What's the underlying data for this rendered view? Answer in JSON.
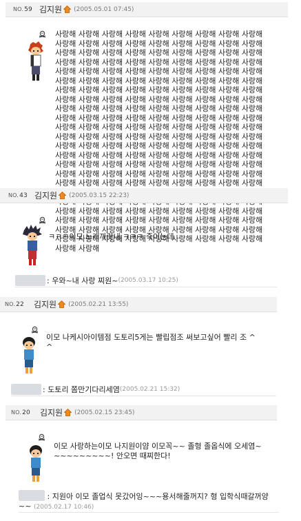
{
  "posts": [
    {
      "no_label": "NO.",
      "no": "59",
      "author": "김지원",
      "date": "(2005.05.01 07:45)",
      "body": "사랑해 사랑해 사랑해 사랑해 사랑해 사랑해 사랑해 사랑해 사랑해 사랑해 사랑해 사랑해 사랑해 사랑해 사랑해 사랑해 사랑해 사랑해 사랑해 사랑해 사랑해 사랑해 사랑해 사랑해 사랑해 사랑해 사랑해 사랑해 사랑해 사랑해 사랑해 사랑해 사랑해 사랑해 사랑해 사랑해 사랑해 사랑해 사랑해 사랑해 사랑해 사랑해 사랑해 사랑해 사랑해 사랑해 사랑해 사랑해 사랑해 사랑해 사랑해 사랑해 사랑해 사랑해 사랑해 사랑해 사랑해 사랑해 사랑해 사랑해 사랑해 사랑해 사랑해 사랑해 사랑해 사랑해 사랑해 사랑해 사랑해 사랑해 사랑해 사랑해 사랑해 사랑해 사랑해 사랑해 사랑해 사랑해 사랑해 사랑해 사랑해 사랑해 사랑해 사랑해 사랑해 사랑해 사랑해 사랑해 사랑해 사랑해 사랑해 사랑해 사랑해 사랑해 사랑해 사랑해 사랑해 사랑해 사랑해 사랑해 사랑해 사랑해 사랑해 사랑해 사랑해 사랑해 사랑해 사랑해 사랑해 사랑해 사랑해 사랑해 사랑해 사랑해 사랑해 사랑해 사랑해 사랑해 사랑해 사랑해 사랑해 사랑해 사랑해 사랑해 사랑해 사랑해 사랑해 사랑해 사랑해 사랑해 사랑해 사랑해 사랑해 사랑해 사랑해 사랑해 사랑해 사랑해 사랑해 사랑해 사랑해 사랑해 사랑해 사랑해 사랑해 사랑해 사랑해 사랑해 사랑해 사랑해 사랑해 사랑해 사랑해 사랑해 사랑해 사랑해 사랑해 사랑해 사랑해 사랑해 사랑해 사랑해 사랑해 사랑해 사랑해 사랑해 사랑해 사랑해 사랑해 사랑해 사랑해 사랑해 사랑해 사랑해 사랑해 사랑해 사랑해 사랑해 사랑해 사랑해 사랑해 사랑해 사랑해 사랑해 사랑해 사랑해 사랑해 사랑해 사랑해 사랑해 사랑해 사랑해 사랑해 사랑해 사랑해 사랑해 사랑해 사랑해 사랑해 사랑해 사랑해 사랑해 사랑해 사랑해 사랑해 사랑해 사랑해 사랑해 사랑해"
    },
    {
      "no_label": "NO.",
      "no": "43",
      "author": "김지원",
      "date": "(2005.03.15 22:23)",
      "body": "ㅋㅋㅋ이모 노래까랏내 ㅋㅋㅋ 죽이는데",
      "comment": {
        "text": ": 우와~내 사랑 찌원~",
        "date": "(2005.03.17 10:25)"
      }
    },
    {
      "no_label": "NO.",
      "no": "22",
      "author": "김지원",
      "date": "(2005.02.21 13:55)",
      "body": "이모 나케시아이템점 도토리5게는 빨립점조 써보고싶어 빨리 조 ^^",
      "comment": {
        "text": ": 도토리 쫌만기다리세염",
        "date": "(2005.02.21 15:32)"
      }
    },
    {
      "no_label": "NO.",
      "no": "20",
      "author": "김지원",
      "date": "(2005.02.15 23:45)",
      "body": "이모 사랑하는이모 나지원이얌 이모꼭~~ 졸형 졸옵식에 오세염~~~~~~~~~~! 안오면 때찌한다!",
      "comment": {
        "text": ": 지원아 이모 졸업식 못갔어잉~~~용서해줄꺼지? 형 입학식때갈꺼양~~",
        "date": "(2005.02.17 10:46)"
      }
    }
  ],
  "icons": {
    "home": "home-icon",
    "delete": "skull-icon"
  },
  "colors": {
    "header_bg": "#f2f2f2",
    "home_orange": "#f08a1c",
    "date_gray": "#7a7a7a"
  }
}
